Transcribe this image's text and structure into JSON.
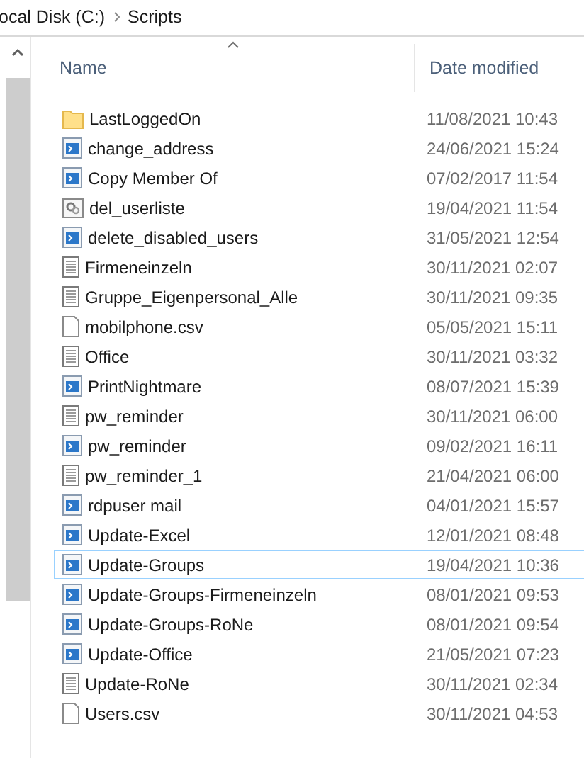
{
  "breadcrumb": [
    "ocal Disk (C:)",
    "Scripts"
  ],
  "columns": [
    {
      "label": "Name",
      "sorted": true
    },
    {
      "label": "Date modified",
      "sorted": false
    }
  ],
  "files": [
    {
      "name": "LastLoggedOn",
      "date": "11/08/2021 10:43",
      "kind": "folder",
      "focused": false
    },
    {
      "name": "change_address",
      "date": "24/06/2021 15:24",
      "kind": "script",
      "focused": false
    },
    {
      "name": "Copy Member Of",
      "date": "07/02/2017 11:54",
      "kind": "script",
      "focused": false
    },
    {
      "name": "del_userliste",
      "date": "19/04/2021 11:54",
      "kind": "batch",
      "focused": false
    },
    {
      "name": "delete_disabled_users",
      "date": "31/05/2021 12:54",
      "kind": "script",
      "focused": false
    },
    {
      "name": "Firmeneinzeln",
      "date": "30/11/2021 02:07",
      "kind": "text",
      "focused": false
    },
    {
      "name": "Gruppe_Eigenpersonal_Alle",
      "date": "30/11/2021 09:35",
      "kind": "text",
      "focused": false
    },
    {
      "name": "mobilphone.csv",
      "date": "05/05/2021 15:11",
      "kind": "file",
      "focused": false
    },
    {
      "name": "Office",
      "date": "30/11/2021 03:32",
      "kind": "text",
      "focused": false
    },
    {
      "name": "PrintNightmare",
      "date": "08/07/2021 15:39",
      "kind": "script",
      "focused": false
    },
    {
      "name": "pw_reminder",
      "date": "30/11/2021 06:00",
      "kind": "text",
      "focused": false
    },
    {
      "name": "pw_reminder",
      "date": "09/02/2021 16:11",
      "kind": "script",
      "focused": false
    },
    {
      "name": "pw_reminder_1",
      "date": "21/04/2021 06:00",
      "kind": "text",
      "focused": false
    },
    {
      "name": "rdpuser mail",
      "date": "04/01/2021 15:57",
      "kind": "script",
      "focused": false
    },
    {
      "name": "Update-Excel",
      "date": "12/01/2021 08:48",
      "kind": "script",
      "focused": false
    },
    {
      "name": "Update-Groups",
      "date": "19/04/2021 10:36",
      "kind": "script",
      "focused": true
    },
    {
      "name": "Update-Groups-Firmeneinzeln",
      "date": "08/01/2021 09:53",
      "kind": "script",
      "focused": false
    },
    {
      "name": "Update-Groups-RoNe",
      "date": "08/01/2021 09:54",
      "kind": "script",
      "focused": false
    },
    {
      "name": "Update-Office",
      "date": "21/05/2021 07:23",
      "kind": "script",
      "focused": false
    },
    {
      "name": "Update-RoNe",
      "date": "30/11/2021 02:34",
      "kind": "text",
      "focused": false
    },
    {
      "name": "Users.csv",
      "date": "30/11/2021 04:53",
      "kind": "file",
      "focused": false
    }
  ]
}
